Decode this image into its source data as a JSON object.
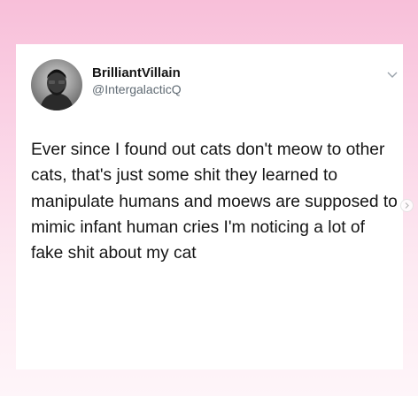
{
  "tweet": {
    "author_name": "BrilliantVillain",
    "author_handle": "@IntergalacticQ",
    "text": "Ever since I found out cats don't meow to other cats, that's just some shit they learned to manipulate humans and moews are supposed to mimic infant human cries I'm noticing a lot of fake shit about my cat"
  },
  "icons": {
    "avatar": "profile-photo-icon",
    "menu": "chevron-down-icon",
    "next": "chevron-right-icon"
  },
  "colors": {
    "background_top": "#f8bfd9",
    "background_bottom": "#fef5f9",
    "card": "#ffffff",
    "text": "#151515",
    "handle": "#5f6a73"
  }
}
